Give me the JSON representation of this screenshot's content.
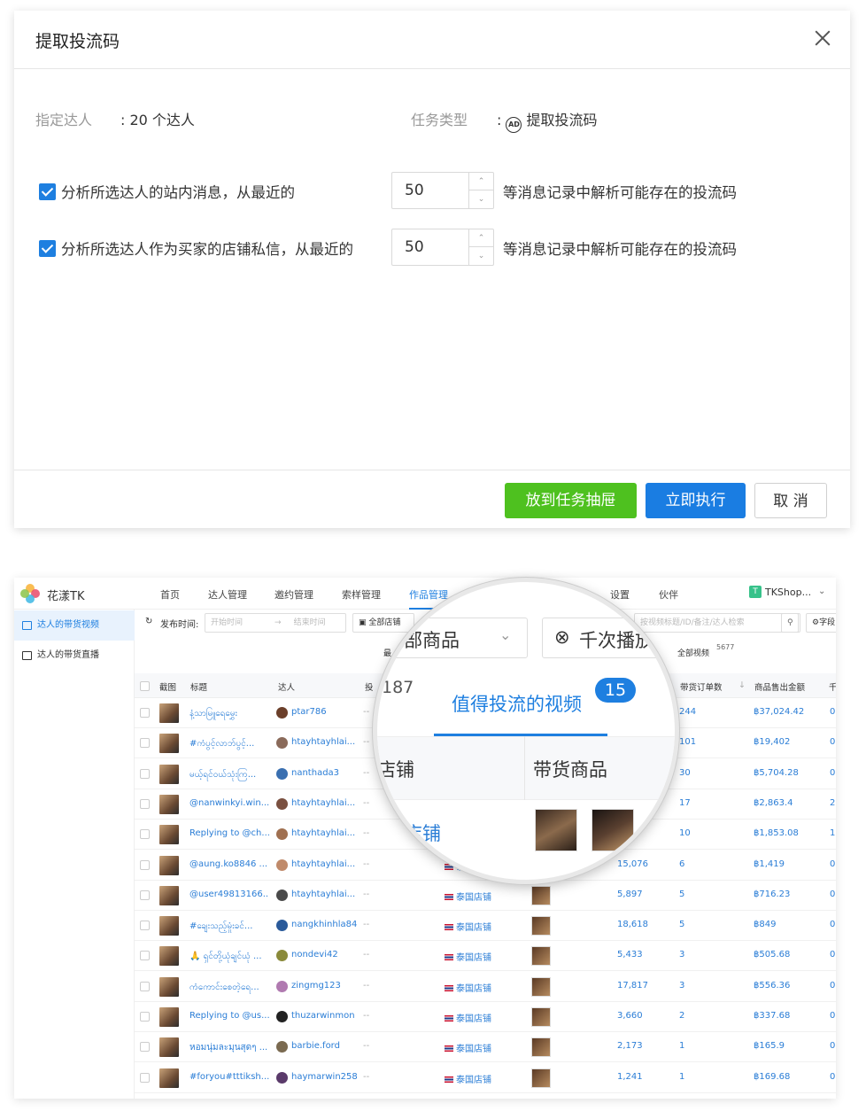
{
  "dialog": {
    "title": "提取投流码",
    "assign_label": "指定达人",
    "assign_value": ": 20 个达人",
    "task_label": "任务类型",
    "task_sep": ":",
    "task_value": "提取投流码",
    "task_icon": "ad-icon",
    "options": [
      {
        "checked": true,
        "label": "分析所选达人的站内消息，从最近的",
        "count": "50",
        "suffix": "等消息记录中解析可能存在的投流码"
      },
      {
        "checked": true,
        "label": "分析所选达人作为买家的店铺私信，从最近的",
        "count": "50",
        "suffix": "等消息记录中解析可能存在的投流码"
      }
    ],
    "btn_drawer": "放到任务抽屉",
    "btn_exec": "立即执行",
    "btn_cancel": "取 消"
  },
  "app": {
    "name": "花漾TK",
    "nav": [
      "首页",
      "达人管理",
      "邀约管理",
      "索样管理",
      "作品管理",
      "设置",
      "伙伴"
    ],
    "nav_active": "作品管理",
    "shop_name": "TKShop...",
    "shop_icon": "T",
    "sidebar": [
      "达人的带货视频",
      "达人的带货直播"
    ],
    "filter": {
      "publish_label": "发布时间:",
      "start_placeholder": "开始时间",
      "end_placeholder": "结束时间",
      "store_select": "全部店铺",
      "search_placeholder": "按视频标题/ID/备注/达人检索",
      "fields_label": "字段"
    },
    "stats": {
      "all_label": "全部视频",
      "all_count": "5677",
      "left_label": "最"
    },
    "columns": [
      "截图",
      "标题",
      "达人",
      "投",
      "带货订单数",
      "商品售出金额",
      "千"
    ],
    "rows": [
      {
        "title": "နံ့သာမြူရေမွှေး",
        "user": "ptar786",
        "views": "",
        "orders": "244",
        "amount": "฿37,024.42",
        "last": "0."
      },
      {
        "title": "#ကံပွင့်လာဘ်ပွင့်...",
        "user": "htayhtayhlai...",
        "views": "",
        "orders": "101",
        "amount": "฿19,402",
        "last": "0."
      },
      {
        "title": "မယ့်ရင်ဝယ်သုံးကြ...",
        "user": "nanthada3",
        "views": "",
        "orders": "30",
        "amount": "฿5,704.28",
        "last": "0."
      },
      {
        "title": "@nanwinkyi.win...",
        "user": "htayhtayhlai...",
        "views": "",
        "orders": "17",
        "amount": "฿2,863.4",
        "last": "2."
      },
      {
        "title": "Replying to @ch...",
        "user": "htayhtayhlai...",
        "views": "",
        "orders": "10",
        "amount": "฿1,853.08",
        "last": "1."
      },
      {
        "title": "@aung.ko8846 ...",
        "user": "htayhtayhlai...",
        "views": "15,076",
        "orders": "6",
        "amount": "฿1,419",
        "last": "0."
      },
      {
        "title": "@user49813166...",
        "user": "htayhtayhlai...",
        "views": "5,897",
        "orders": "5",
        "amount": "฿716.23",
        "last": "0."
      },
      {
        "title": "#ချေးသည့်မှုံးခင်...",
        "user": "nangkhinhla84",
        "views": "18,618",
        "orders": "5",
        "amount": "฿849",
        "last": "0."
      },
      {
        "title": "🙏 ရှင်တို့ယုံချင်ယုံ ...",
        "user": "nondevi42",
        "views": "5,433",
        "orders": "3",
        "amount": "฿505.68",
        "last": "0."
      },
      {
        "title": "ကံကောင်းစေတဲ့ရေ...",
        "user": "zingmg123",
        "views": "17,817",
        "orders": "3",
        "amount": "฿556.36",
        "last": "0."
      },
      {
        "title": "Replying to @us...",
        "user": "thuzarwinmon",
        "views": "3,660",
        "orders": "2",
        "amount": "฿337.68",
        "last": "0."
      },
      {
        "title": "หอมนุ่มละมุนสุดๆ ...",
        "user": "barbie.ford",
        "views": "2,173",
        "orders": "1",
        "amount": "฿165.9",
        "last": "0."
      },
      {
        "title": "#foryou#tttiksh...",
        "user": "haymarwin258",
        "views": "1,241",
        "orders": "1",
        "amount": "฿169.68",
        "last": "0."
      }
    ],
    "store_text": "泰国店铺",
    "dash": "--"
  },
  "magnifier": {
    "select_text": "部商品",
    "play_btn": "千次播放",
    "count_left": "187",
    "tab": "值得投流的视频",
    "tab_badge": "15",
    "col_store": "店铺",
    "col_goods": "带货商品",
    "cell_store": "店铺"
  }
}
